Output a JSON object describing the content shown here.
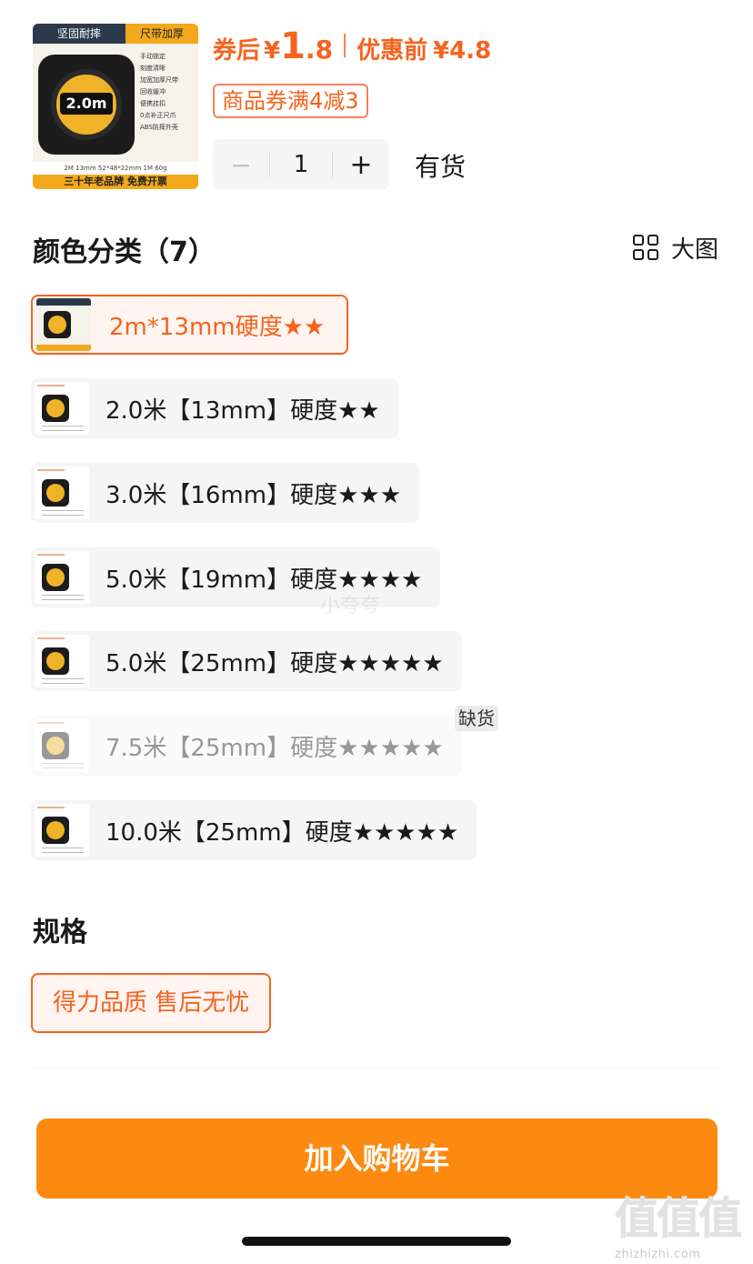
{
  "product": {
    "thumb_tag_left": "坚固耐摔",
    "thumb_tag_right": "尺带加厚",
    "thumb_size": "2.0m",
    "thumb_features": [
      "手动锁定",
      "刻度清晰",
      "加宽加厚尺带",
      "回收缓冲",
      "便携挂扣",
      "0点补正尺爪",
      "ABS防摔外壳"
    ],
    "thumb_spec": "2M  13mm  52*48*22mm  1M  60g",
    "thumb_footer": "三十年老品牌  免费开票"
  },
  "price": {
    "after_coupon_label": "券后",
    "currency": "¥",
    "after_coupon_int": "1",
    "after_coupon_dec": ".8",
    "before_label": "优惠前",
    "before_value": "¥4.8",
    "accent_color": "#f5631e"
  },
  "coupon": {
    "text": "商品券满4减3"
  },
  "quantity": {
    "minus": "−",
    "value": "1",
    "plus": "+"
  },
  "stock": {
    "text": "有货"
  },
  "color_section": {
    "title": "颜色分类（7）",
    "big_view_label": "大图",
    "options": [
      {
        "label": "2m*13mm硬度★★",
        "state": "selected"
      },
      {
        "label": "2.0米【13mm】硬度★★",
        "state": "normal"
      },
      {
        "label": "3.0米【16mm】硬度★★★",
        "state": "normal"
      },
      {
        "label": "5.0米【19mm】硬度★★★★",
        "state": "normal"
      },
      {
        "label": "5.0米【25mm】硬度★★★★★",
        "state": "normal"
      },
      {
        "label": "7.5米【25mm】硬度★★★★★",
        "state": "out_of_stock"
      },
      {
        "label": "10.0米【25mm】硬度★★★★★",
        "state": "normal"
      }
    ],
    "out_of_stock_badge": "缺货"
  },
  "spec_section": {
    "title": "规格",
    "option": "得力品质 售后无忧"
  },
  "cart": {
    "button_label": "加入购物车",
    "button_color": "#fc8a11"
  },
  "watermark": {
    "center": "小夸夸",
    "logo": "值值值",
    "url": "zhizhizhi.com"
  }
}
